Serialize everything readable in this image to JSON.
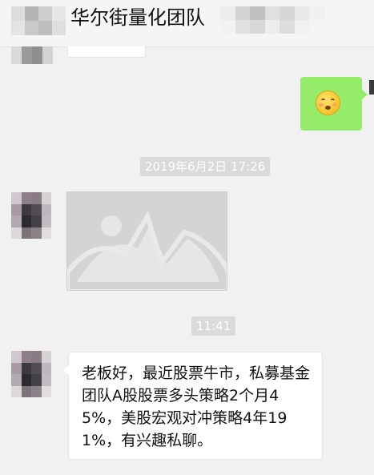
{
  "header": {
    "title": "华尔街量化团队"
  },
  "messages": {
    "timestamp_1": "2019年6月2日 17:26",
    "timestamp_2": "11:41",
    "sent_emoji_icon": "blushing-smile-emoji",
    "received_text": "老板好，最近股票牛市，私募基金团队A股股票多头策略2个月45%，美股宏观对冲策略4年191%，有兴趣私聊。"
  },
  "colors": {
    "background": "#f1f1f1",
    "sent_bubble": "#95ec69",
    "received_bubble": "#ffffff",
    "timestamp_chip": "#dadada",
    "image_placeholder": "#d4d4d4"
  }
}
